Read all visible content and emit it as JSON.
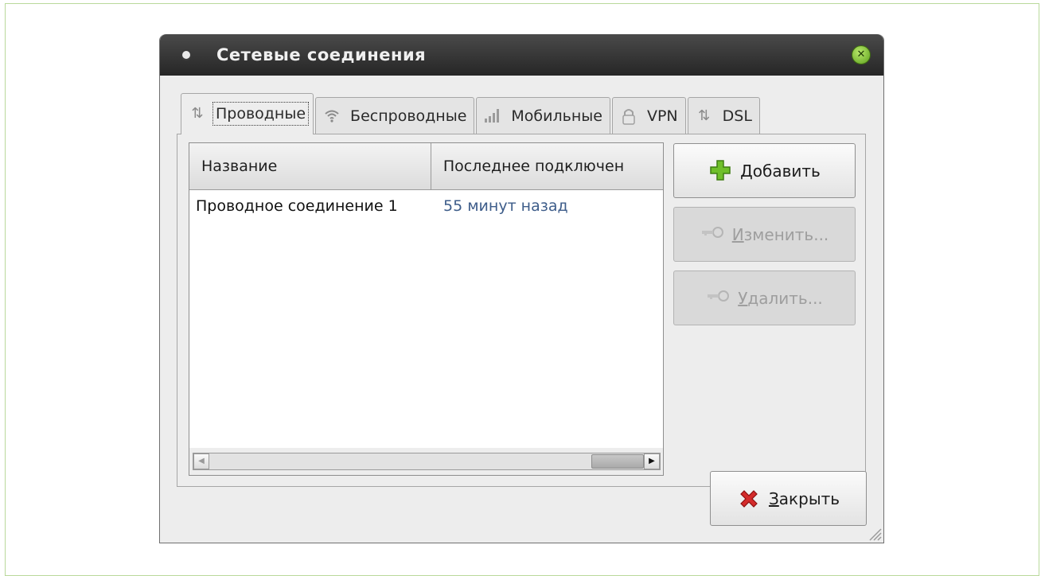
{
  "window": {
    "title": "Сетевые соединения"
  },
  "tabs": [
    {
      "label": "Проводные",
      "icon": "wired-icon"
    },
    {
      "label": "Беспроводные",
      "icon": "wifi-icon"
    },
    {
      "label": "Мобильные",
      "icon": "signal-bars-icon"
    },
    {
      "label": "VPN",
      "icon": "lock-icon"
    },
    {
      "label": "DSL",
      "icon": "dsl-icon"
    }
  ],
  "active_tab": "Проводные",
  "table": {
    "columns": [
      "Название",
      "Последнее подключен"
    ],
    "rows": [
      {
        "name": "Проводное соединение 1",
        "last_used": "55 минут назад"
      }
    ]
  },
  "buttons": {
    "add": {
      "label": "Добавить",
      "mnemonic": "Д",
      "rest": "обавить",
      "enabled": true
    },
    "edit": {
      "label": "Изменить...",
      "mnemonic": "И",
      "rest": "зменить...",
      "enabled": false
    },
    "delete": {
      "label": "Удалить...",
      "mnemonic": "У",
      "rest": "далить...",
      "enabled": false
    },
    "close": {
      "label": "Закрыть",
      "mnemonic": "З",
      "rest": "акрыть",
      "enabled": true
    }
  },
  "colors": {
    "titlebar": "#2e2e2e",
    "close_button": "#7ec43a",
    "time_text": "#3e5d8a",
    "frame": "#b9d99b"
  }
}
